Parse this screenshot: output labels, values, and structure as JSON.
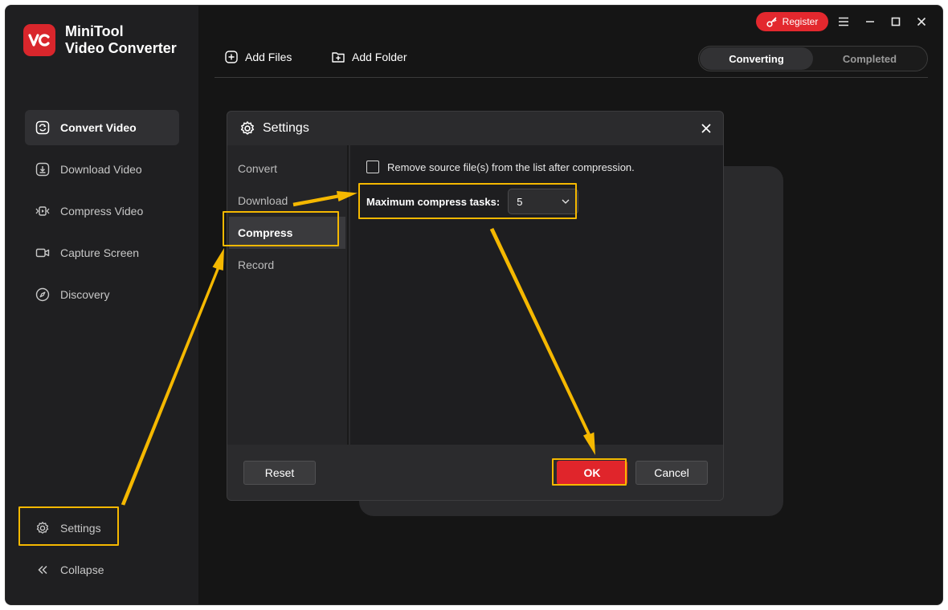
{
  "app": {
    "brand_line1": "MiniTool",
    "brand_line2": "Video Converter",
    "logo_text": "VC",
    "accent_color": "#e3282e",
    "highlight_color": "#f5b800"
  },
  "sidebar": {
    "items": [
      {
        "label": "Convert Video",
        "icon": "convert-icon",
        "active": true
      },
      {
        "label": "Download Video",
        "icon": "download-icon"
      },
      {
        "label": "Compress Video",
        "icon": "compress-icon"
      },
      {
        "label": "Capture Screen",
        "icon": "camera-icon"
      },
      {
        "label": "Discovery",
        "icon": "compass-icon"
      }
    ],
    "settings_label": "Settings",
    "collapse_label": "Collapse"
  },
  "header": {
    "register_label": "Register",
    "add_files_label": "Add Files",
    "add_folder_label": "Add Folder",
    "tabs": [
      {
        "label": "Converting",
        "active": true
      },
      {
        "label": "Completed"
      }
    ]
  },
  "dialog": {
    "title": "Settings",
    "tabs": [
      {
        "label": "Convert"
      },
      {
        "label": "Download"
      },
      {
        "label": "Compress",
        "active": true
      },
      {
        "label": "Record"
      }
    ],
    "remove_source_label": "Remove source file(s) from the list after compression.",
    "remove_source_checked": false,
    "max_tasks_label": "Maximum compress tasks:",
    "max_tasks_value": "5",
    "reset_label": "Reset",
    "ok_label": "OK",
    "cancel_label": "Cancel"
  }
}
